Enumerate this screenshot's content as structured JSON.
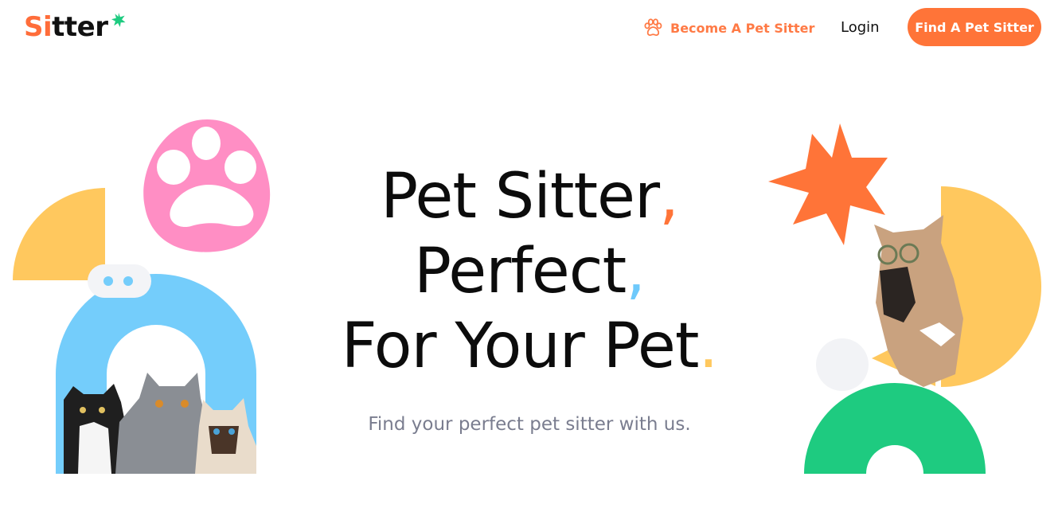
{
  "brand": {
    "logo_part1": "Si",
    "logo_part2": "tter",
    "logo_star_color": "#1ecb80"
  },
  "nav": {
    "become_sitter": "Become A Pet Sitter",
    "login": "Login",
    "find_sitter": "Find A Pet Sitter"
  },
  "hero": {
    "line1": "Pet Sitter",
    "line1_punct": ",",
    "line2": "Perfect",
    "line2_punct": ",",
    "line3": "For Your Pet",
    "line3_punct": ".",
    "subtitle": "Find your perfect pet sitter with us."
  },
  "colors": {
    "accent_orange": "#ff7438",
    "blue": "#6ec9fb",
    "yellow": "#ffc85e",
    "pink": "#ff8ec4",
    "green": "#1ecb80"
  },
  "icons": [
    "paw-icon",
    "star-icon"
  ]
}
